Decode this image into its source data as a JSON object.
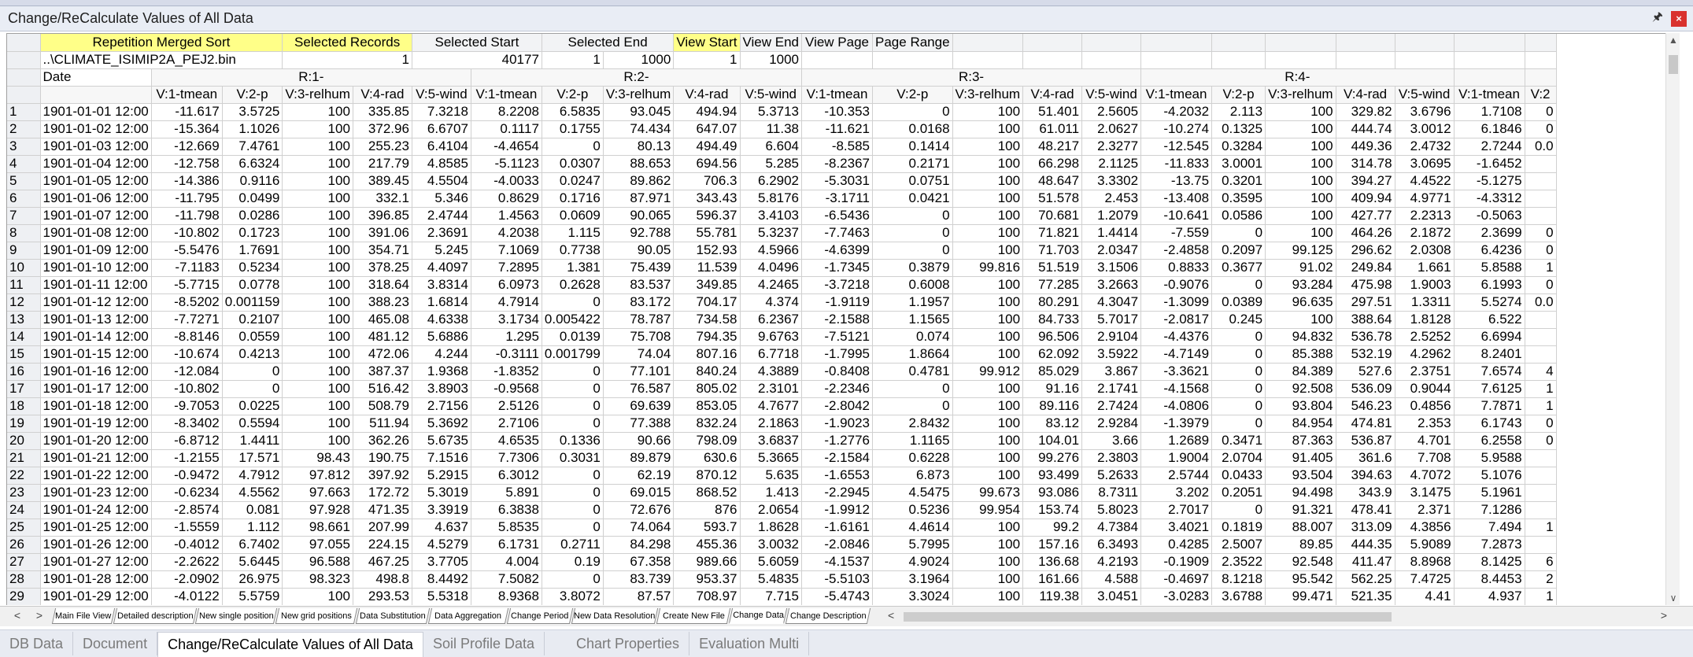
{
  "window": {
    "title": "Change/ReCalculate Values of All Data",
    "pin_glyph": "🖈",
    "close_glyph": "×"
  },
  "top_row": {
    "labels": [
      "Repetition Merged Sort",
      "Selected Records",
      "Selected Start",
      "Selected End",
      "View Start",
      "View End",
      "View Page",
      "Page Range"
    ],
    "highlighted": [
      true,
      true,
      false,
      false,
      true,
      false,
      false,
      false
    ]
  },
  "file_row": {
    "file": "..\\CLIMATE_ISIMIP2A_PEJ2.bin",
    "values": [
      "1",
      "40177",
      "1",
      "1000",
      "1",
      "1000"
    ]
  },
  "group_row": {
    "date_label": "Date",
    "groups": [
      "R:1-",
      "R:2-",
      "R:3-",
      "R:4-"
    ]
  },
  "var_headers": [
    "V:1-tmean",
    "V:2-p",
    "V:3-relhum",
    "V:4-rad",
    "V:5-wind",
    "V:1-tmean",
    "V:2-p",
    "V:3-relhum",
    "V:4-rad",
    "V:5-wind",
    "V:1-tmean",
    "V:2-p",
    "V:3-relhum",
    "V:4-rad",
    "V:5-wind",
    "V:1-tmean",
    "V:2-p",
    "V:3-relhum",
    "V:4-rad",
    "V:5-wind",
    "V:1-tmean",
    "V:2"
  ],
  "rows": [
    {
      "n": "1",
      "date": "1901-01-01 12:00",
      "v": [
        "-11.617",
        "3.5725",
        "100",
        "335.85",
        "7.3218",
        "8.2208",
        "6.5835",
        "93.045",
        "494.94",
        "5.3713",
        "-10.353",
        "0",
        "100",
        "51.401",
        "2.5605",
        "-4.2032",
        "2.113",
        "100",
        "329.82",
        "3.6796",
        "1.7108",
        "0"
      ]
    },
    {
      "n": "2",
      "date": "1901-01-02 12:00",
      "v": [
        "-15.364",
        "1.1026",
        "100",
        "372.96",
        "6.6707",
        "0.1117",
        "0.1755",
        "74.434",
        "647.07",
        "11.38",
        "-11.621",
        "0.0168",
        "100",
        "61.011",
        "2.0627",
        "-10.274",
        "0.1325",
        "100",
        "444.74",
        "3.0012",
        "6.1846",
        "0"
      ]
    },
    {
      "n": "3",
      "date": "1901-01-03 12:00",
      "v": [
        "-12.669",
        "7.4761",
        "100",
        "255.23",
        "6.4104",
        "-4.4654",
        "0",
        "80.13",
        "494.49",
        "6.604",
        "-8.585",
        "0.1414",
        "100",
        "48.217",
        "2.3277",
        "-12.545",
        "0.3284",
        "100",
        "449.36",
        "2.4732",
        "2.7244",
        "0.0"
      ]
    },
    {
      "n": "4",
      "date": "1901-01-04 12:00",
      "v": [
        "-12.758",
        "6.6324",
        "100",
        "217.79",
        "4.8585",
        "-5.1123",
        "0.0307",
        "88.653",
        "694.56",
        "5.285",
        "-8.2367",
        "0.2171",
        "100",
        "66.298",
        "2.1125",
        "-11.833",
        "3.0001",
        "100",
        "314.78",
        "3.0695",
        "-1.6452",
        ""
      ]
    },
    {
      "n": "5",
      "date": "1901-01-05 12:00",
      "v": [
        "-14.386",
        "0.9116",
        "100",
        "389.45",
        "4.5504",
        "-4.0033",
        "0.0247",
        "89.862",
        "706.3",
        "6.2902",
        "-5.3031",
        "0.0751",
        "100",
        "48.647",
        "3.3302",
        "-13.75",
        "0.3201",
        "100",
        "394.27",
        "4.4522",
        "-5.1275",
        ""
      ]
    },
    {
      "n": "6",
      "date": "1901-01-06 12:00",
      "v": [
        "-11.795",
        "0.0499",
        "100",
        "332.1",
        "5.346",
        "0.8629",
        "0.1716",
        "87.971",
        "343.43",
        "5.8176",
        "-3.1711",
        "0.0421",
        "100",
        "51.578",
        "2.453",
        "-13.408",
        "0.3595",
        "100",
        "409.94",
        "4.9771",
        "-4.3312",
        ""
      ]
    },
    {
      "n": "7",
      "date": "1901-01-07 12:00",
      "v": [
        "-11.798",
        "0.0286",
        "100",
        "396.85",
        "2.4744",
        "1.4563",
        "0.0609",
        "90.065",
        "596.37",
        "3.4103",
        "-6.5436",
        "0",
        "100",
        "70.681",
        "1.2079",
        "-10.641",
        "0.0586",
        "100",
        "427.77",
        "2.2313",
        "-0.5063",
        ""
      ]
    },
    {
      "n": "8",
      "date": "1901-01-08 12:00",
      "v": [
        "-10.802",
        "0.1723",
        "100",
        "391.06",
        "2.3691",
        "4.2038",
        "1.115",
        "92.788",
        "55.781",
        "5.3237",
        "-7.7463",
        "0",
        "100",
        "71.821",
        "1.4414",
        "-7.559",
        "0",
        "100",
        "464.26",
        "2.1872",
        "2.3699",
        "0"
      ]
    },
    {
      "n": "9",
      "date": "1901-01-09 12:00",
      "v": [
        "-5.5476",
        "1.7691",
        "100",
        "354.71",
        "5.245",
        "7.1069",
        "0.7738",
        "90.05",
        "152.93",
        "4.5966",
        "-4.6399",
        "0",
        "100",
        "71.703",
        "2.0347",
        "-2.4858",
        "0.2097",
        "99.125",
        "296.62",
        "2.0308",
        "6.4236",
        "0"
      ]
    },
    {
      "n": "10",
      "date": "1901-01-10 12:00",
      "v": [
        "-7.1183",
        "0.5234",
        "100",
        "378.25",
        "4.4097",
        "7.2895",
        "1.381",
        "75.439",
        "11.539",
        "4.0496",
        "-1.7345",
        "0.3879",
        "99.816",
        "51.519",
        "3.1506",
        "0.8833",
        "0.3677",
        "91.02",
        "249.84",
        "1.661",
        "5.8588",
        "1"
      ]
    },
    {
      "n": "11",
      "date": "1901-01-11 12:00",
      "v": [
        "-5.7715",
        "0.0778",
        "100",
        "318.64",
        "3.8314",
        "6.0973",
        "0.2628",
        "83.537",
        "349.85",
        "4.2465",
        "-3.7218",
        "0.6008",
        "100",
        "77.285",
        "3.2663",
        "-0.9076",
        "0",
        "93.284",
        "475.98",
        "1.9003",
        "6.1993",
        "0"
      ]
    },
    {
      "n": "12",
      "date": "1901-01-12 12:00",
      "v": [
        "-8.5202",
        "0.001159",
        "100",
        "388.23",
        "1.6814",
        "4.7914",
        "0",
        "83.172",
        "704.17",
        "4.374",
        "-1.9119",
        "1.1957",
        "100",
        "80.291",
        "4.3047",
        "-1.3099",
        "0.0389",
        "96.635",
        "297.51",
        "1.3311",
        "5.5274",
        "0.0"
      ]
    },
    {
      "n": "13",
      "date": "1901-01-13 12:00",
      "v": [
        "-7.7271",
        "0.2107",
        "100",
        "465.08",
        "4.6338",
        "3.1734",
        "0.005422",
        "78.787",
        "734.58",
        "6.2367",
        "-2.1588",
        "1.1565",
        "100",
        "84.733",
        "5.7017",
        "-2.0817",
        "0.245",
        "100",
        "388.64",
        "1.8128",
        "6.522",
        ""
      ]
    },
    {
      "n": "14",
      "date": "1901-01-14 12:00",
      "v": [
        "-8.8146",
        "0.0559",
        "100",
        "481.12",
        "5.6886",
        "1.295",
        "0.0139",
        "75.708",
        "794.35",
        "9.6763",
        "-7.5121",
        "0.074",
        "100",
        "96.506",
        "2.9104",
        "-4.4376",
        "0",
        "94.832",
        "536.78",
        "2.5252",
        "6.6994",
        ""
      ]
    },
    {
      "n": "15",
      "date": "1901-01-15 12:00",
      "v": [
        "-10.674",
        "0.4213",
        "100",
        "472.06",
        "4.244",
        "-0.3111",
        "0.001799",
        "74.04",
        "807.16",
        "6.7718",
        "-1.7995",
        "1.8664",
        "100",
        "62.092",
        "3.5922",
        "-4.7149",
        "0",
        "85.388",
        "532.19",
        "4.2962",
        "8.2401",
        ""
      ]
    },
    {
      "n": "16",
      "date": "1901-01-16 12:00",
      "v": [
        "-12.084",
        "0",
        "100",
        "387.37",
        "1.9368",
        "-1.8352",
        "0",
        "77.101",
        "840.24",
        "4.3889",
        "-0.8408",
        "0.4781",
        "99.912",
        "85.029",
        "3.867",
        "-3.3621",
        "0",
        "84.389",
        "527.6",
        "2.3751",
        "7.6574",
        "4"
      ]
    },
    {
      "n": "17",
      "date": "1901-01-17 12:00",
      "v": [
        "-10.802",
        "0",
        "100",
        "516.42",
        "3.8903",
        "-0.9568",
        "0",
        "76.587",
        "805.02",
        "2.3101",
        "-2.2346",
        "0",
        "100",
        "91.16",
        "2.1741",
        "-4.1568",
        "0",
        "92.508",
        "536.09",
        "0.9044",
        "7.6125",
        "1"
      ]
    },
    {
      "n": "18",
      "date": "1901-01-18 12:00",
      "v": [
        "-9.7053",
        "0.0225",
        "100",
        "508.79",
        "2.7156",
        "2.5126",
        "0",
        "69.639",
        "853.05",
        "4.7677",
        "-2.8042",
        "0",
        "100",
        "89.116",
        "2.7424",
        "-4.0806",
        "0",
        "93.804",
        "546.23",
        "0.4856",
        "7.7871",
        "1"
      ]
    },
    {
      "n": "19",
      "date": "1901-01-19 12:00",
      "v": [
        "-8.3402",
        "0.5594",
        "100",
        "511.94",
        "5.3692",
        "2.7106",
        "0",
        "77.388",
        "832.24",
        "2.1863",
        "-1.9023",
        "2.8432",
        "100",
        "83.12",
        "2.9284",
        "-1.3979",
        "0",
        "84.954",
        "474.81",
        "2.353",
        "6.1743",
        "0"
      ]
    },
    {
      "n": "20",
      "date": "1901-01-20 12:00",
      "v": [
        "-6.8712",
        "1.4411",
        "100",
        "362.26",
        "5.6735",
        "4.6535",
        "0.1336",
        "90.66",
        "798.09",
        "3.6837",
        "-1.2776",
        "1.1165",
        "100",
        "104.01",
        "3.66",
        "1.2689",
        "0.3471",
        "87.363",
        "536.87",
        "4.701",
        "6.2558",
        "0"
      ]
    },
    {
      "n": "21",
      "date": "1901-01-21 12:00",
      "v": [
        "-1.2155",
        "17.571",
        "98.43",
        "190.75",
        "7.1516",
        "7.7306",
        "0.3031",
        "89.879",
        "630.6",
        "5.3665",
        "-2.1584",
        "0.6228",
        "100",
        "99.276",
        "2.3803",
        "1.9004",
        "2.0704",
        "91.405",
        "361.6",
        "7.708",
        "5.9588",
        ""
      ]
    },
    {
      "n": "22",
      "date": "1901-01-22 12:00",
      "v": [
        "-0.9472",
        "4.7912",
        "97.812",
        "397.92",
        "5.2915",
        "6.3012",
        "0",
        "62.19",
        "870.12",
        "5.635",
        "-1.6553",
        "6.873",
        "100",
        "93.499",
        "5.2633",
        "2.5744",
        "0.0433",
        "93.504",
        "394.63",
        "4.7072",
        "5.1076",
        ""
      ]
    },
    {
      "n": "23",
      "date": "1901-01-23 12:00",
      "v": [
        "-0.6234",
        "4.5562",
        "97.663",
        "172.72",
        "5.3019",
        "5.891",
        "0",
        "69.015",
        "868.52",
        "1.413",
        "-2.2945",
        "4.5475",
        "99.673",
        "93.086",
        "8.7311",
        "3.202",
        "0.2051",
        "94.498",
        "343.9",
        "3.1475",
        "5.1961",
        ""
      ]
    },
    {
      "n": "24",
      "date": "1901-01-24 12:00",
      "v": [
        "-2.8574",
        "0.081",
        "97.928",
        "471.35",
        "3.3919",
        "6.3838",
        "0",
        "72.676",
        "876",
        "2.0654",
        "-1.9912",
        "0.5236",
        "99.954",
        "153.74",
        "5.8023",
        "2.7017",
        "0",
        "91.321",
        "478.41",
        "2.371",
        "7.1286",
        ""
      ]
    },
    {
      "n": "25",
      "date": "1901-01-25 12:00",
      "v": [
        "-1.5559",
        "1.112",
        "98.661",
        "207.99",
        "4.637",
        "5.8535",
        "0",
        "74.064",
        "593.7",
        "1.8628",
        "-1.6161",
        "4.4614",
        "100",
        "99.2",
        "4.7384",
        "3.4021",
        "0.1819",
        "88.007",
        "313.09",
        "4.3856",
        "7.494",
        "1"
      ]
    },
    {
      "n": "26",
      "date": "1901-01-26 12:00",
      "v": [
        "-0.4012",
        "6.7402",
        "97.055",
        "224.15",
        "4.5279",
        "6.1731",
        "0.2711",
        "84.298",
        "455.36",
        "3.0032",
        "-2.0846",
        "5.7995",
        "100",
        "157.16",
        "6.3493",
        "0.4285",
        "2.5007",
        "89.85",
        "444.35",
        "5.9089",
        "7.2873",
        ""
      ]
    },
    {
      "n": "27",
      "date": "1901-01-27 12:00",
      "v": [
        "-2.2622",
        "5.6445",
        "96.588",
        "467.25",
        "3.7705",
        "4.004",
        "0.19",
        "67.358",
        "989.66",
        "5.6059",
        "-4.1537",
        "4.9024",
        "100",
        "136.68",
        "4.2193",
        "-0.1909",
        "2.3522",
        "92.548",
        "411.47",
        "8.8968",
        "8.1425",
        "6"
      ]
    },
    {
      "n": "28",
      "date": "1901-01-28 12:00",
      "v": [
        "-2.0902",
        "26.975",
        "98.323",
        "498.8",
        "8.4492",
        "7.5082",
        "0",
        "83.739",
        "953.37",
        "5.4835",
        "-5.5103",
        "3.1964",
        "100",
        "161.66",
        "4.588",
        "-0.4697",
        "8.1218",
        "95.542",
        "562.25",
        "7.4725",
        "8.4453",
        "2"
      ]
    },
    {
      "n": "29",
      "date": "1901-01-29 12:00",
      "v": [
        "-4.0122",
        "5.5759",
        "100",
        "293.53",
        "5.5318",
        "8.9368",
        "3.8072",
        "87.57",
        "708.97",
        "7.715",
        "-5.4743",
        "3.3024",
        "100",
        "119.38",
        "3.0451",
        "-3.0283",
        "3.6788",
        "99.471",
        "521.35",
        "4.41",
        "4.937",
        "1"
      ]
    }
  ],
  "sheet_tabs": [
    "Main File View",
    "Detailed description",
    "New single position",
    "New grid positions",
    "Data Substitution",
    "Data Aggregation",
    "Change Period",
    "New Data Resolution",
    "Create New File",
    "Change Data",
    "Change Description"
  ],
  "active_sheet_tab": "Change Data",
  "nav": {
    "left": "<",
    "right": ">",
    "hleft": "<",
    "hright": ">",
    "up": "▲",
    "down": "∨"
  },
  "bottom_tabs": [
    "DB Data",
    "Document",
    "Change/ReCalculate Values of All Data",
    "Soil Profile Data",
    "Chart Properties",
    "Evaluation Multi"
  ],
  "active_bottom_tab": "Change/ReCalculate Values of All Data"
}
